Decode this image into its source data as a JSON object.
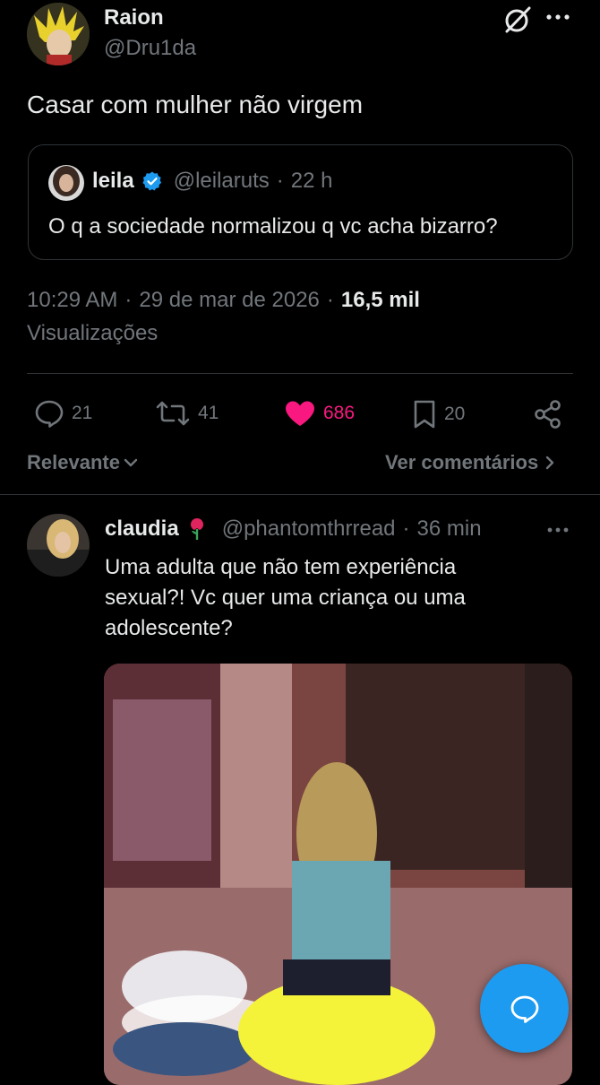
{
  "tweet": {
    "author_name": "Raion",
    "author_handle": "@Dru1da",
    "text": "Casar com mulher não virgem",
    "time": "10:29 AM",
    "date": "29 de mar de 2026",
    "views_count": "16,5 mil",
    "views_label": "Visualizações"
  },
  "quoted": {
    "author_name": "leila",
    "author_handle": "@leilaruts",
    "age": "22 h",
    "text": "O q a sociedade normalizou q vc acha bizarro?"
  },
  "actions": {
    "replies": "21",
    "retweets": "41",
    "likes": "686",
    "bookmarks": "20"
  },
  "sort": {
    "label": "Relevante",
    "see_comments": "Ver comentários"
  },
  "reply": {
    "author_name": "claudia",
    "author_handle": "@phantomthrread",
    "age": "36 min",
    "text_line1": "Uma adulta que não tem experiência",
    "text_line2": "sexual?! Vc quer uma criança ou uma",
    "text_line3": "adolescente?"
  },
  "colors": {
    "background": "#000000",
    "like": "#f91880",
    "verified": "#1d9bf0",
    "fab": "#1d9bf0"
  }
}
